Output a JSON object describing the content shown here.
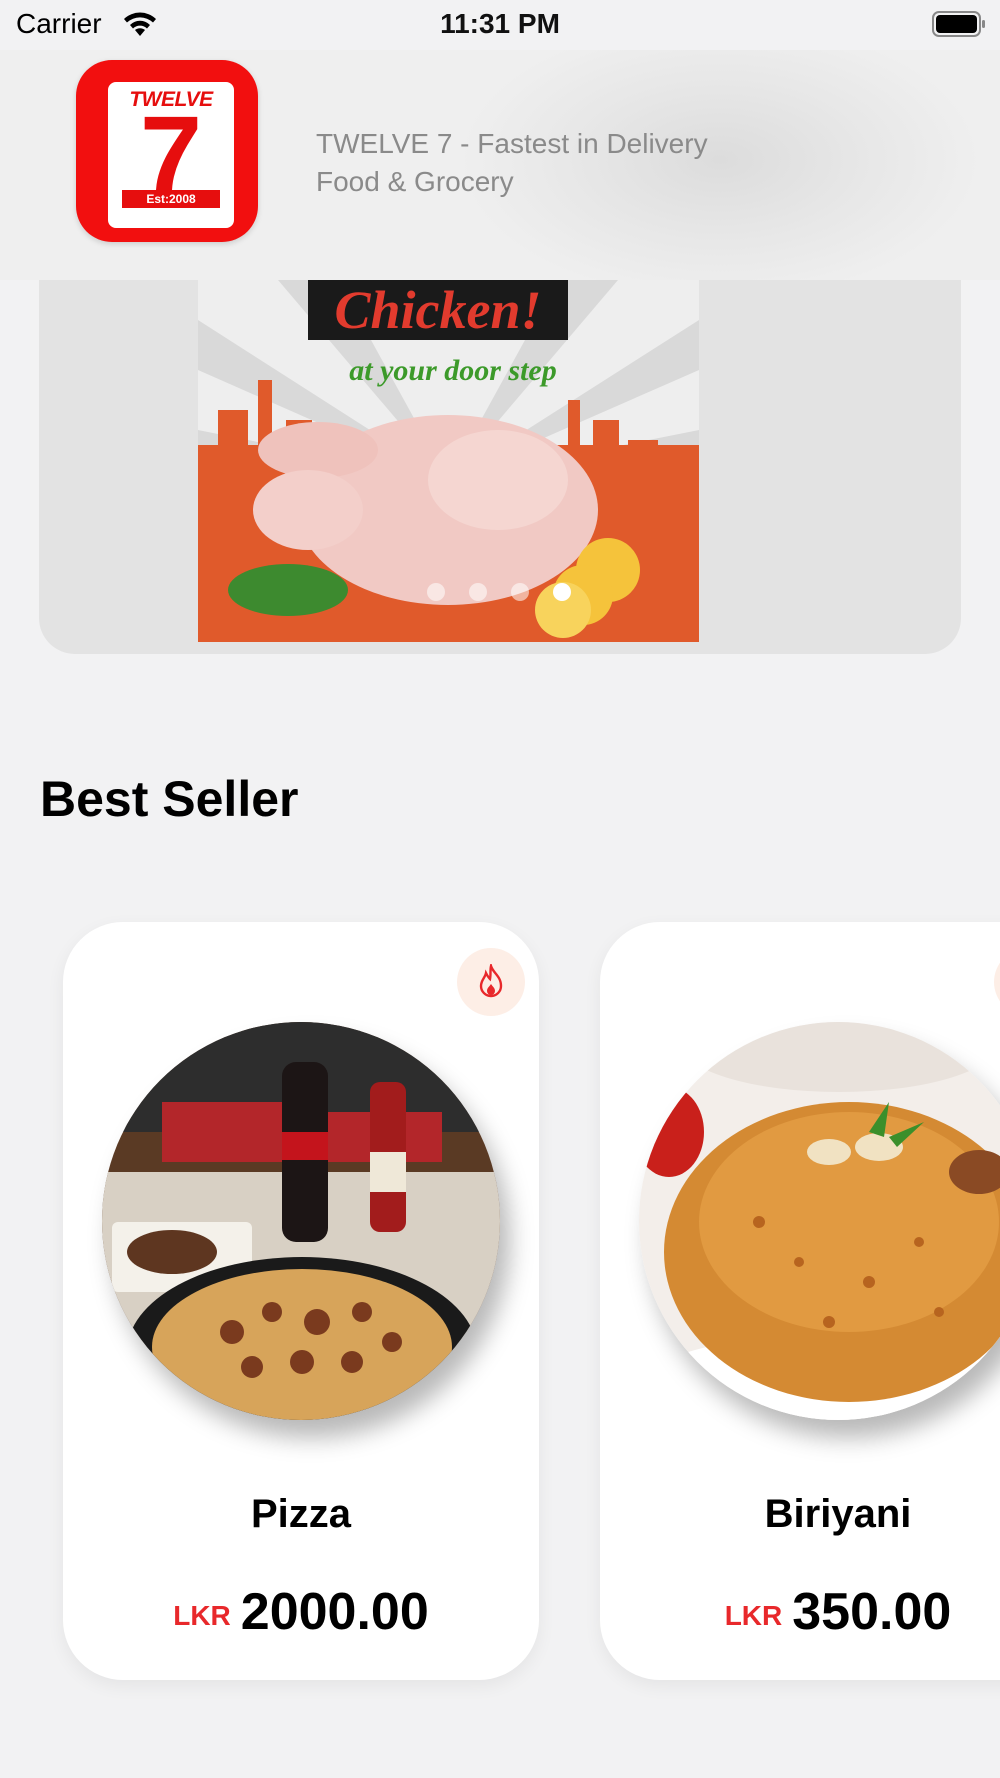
{
  "status_bar": {
    "carrier": "Carrier",
    "time": "11:31 PM"
  },
  "header": {
    "logo_text": "TWELVE",
    "logo_number": "7",
    "logo_est": "Est:2008",
    "subtitle_line1": "TWELVE 7 - Fastest in Delivery",
    "subtitle_line2": "Food & Grocery",
    "brand_color": "#f20f0f"
  },
  "banner": {
    "headline": "Chicken!",
    "tagline": "at your door step",
    "slide_count": 4,
    "active_slide": 4
  },
  "best_seller": {
    "title": "Best Seller",
    "items": [
      {
        "name": "Pizza",
        "currency": "LKR",
        "price": "2000.00",
        "badge_icon": "fire-icon"
      },
      {
        "name": "Biriyani",
        "currency": "LKR",
        "price": "350.00",
        "badge_icon": "fire-icon"
      }
    ]
  },
  "colors": {
    "accent": "#e8282b",
    "background": "#f2f2f3",
    "card": "#ffffff"
  }
}
